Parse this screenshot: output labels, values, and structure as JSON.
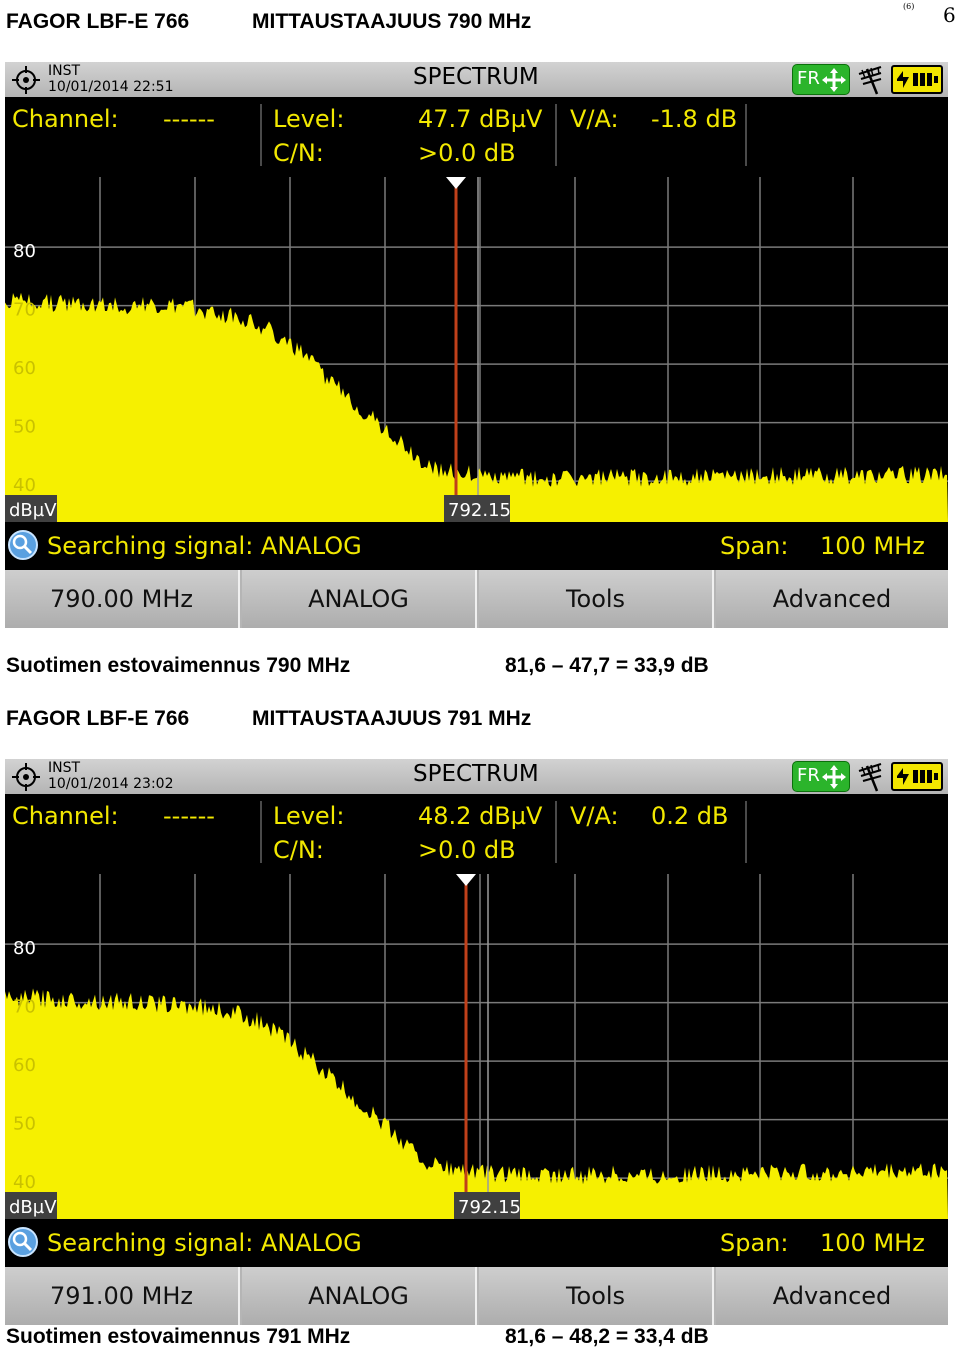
{
  "page": {
    "page_number_small": "(6)",
    "page_number": "6"
  },
  "sections": [
    {
      "model": "FAGOR LBF-E 766",
      "heading": "MITTAUSTAAJUUS 790 MHz",
      "caption": "Suotimen estovaimennus 790 MHz",
      "calculation": "81,6 – 47,7 = 33,9 dB",
      "screen": {
        "mode": "INST",
        "datetime": "10/01/2014 22:51",
        "title": "SPECTRUM",
        "fr_label": "FR",
        "channel_label": "Channel:",
        "channel_value": "------",
        "level_label": "Level:",
        "level_value": "47.7 dBµV",
        "cn_label": "C/N:",
        "cn_value": ">0.0 dB",
        "va_label": "V/A:",
        "va_value": "-1.8 dB",
        "search_text": "Searching signal: ANALOG",
        "span_label": "Span:",
        "span_value": "100 MHz",
        "softkeys": [
          "790.00 MHz",
          "ANALOG",
          "Tools",
          "Advanced"
        ]
      }
    },
    {
      "model": "FAGOR LBF-E 766",
      "heading": "MITTAUSTAAJUUS 791 MHz",
      "caption": "Suotimen estovaimennus 791 MHz",
      "calculation": "81,6 – 48,2 = 33,4 dB",
      "screen": {
        "mode": "INST",
        "datetime": "10/01/2014 23:02",
        "title": "SPECTRUM",
        "fr_label": "FR",
        "channel_label": "Channel:",
        "channel_value": "------",
        "level_label": "Level:",
        "level_value": "48.2 dBµV",
        "cn_label": "C/N:",
        "cn_value": ">0.0 dB",
        "va_label": "V/A:",
        "va_value": "0.2 dB",
        "search_text": "Searching signal: ANALOG",
        "span_label": "Span:",
        "span_value": "100 MHz",
        "softkeys": [
          "791.00 MHz",
          "ANALOG",
          "Tools",
          "Advanced"
        ]
      }
    }
  ],
  "chart_data": [
    {
      "type": "area",
      "title": "SPECTRUM",
      "ylabel": "dBµV",
      "yticks": [
        80,
        70,
        60,
        50,
        40
      ],
      "ylim": [
        33,
        92
      ],
      "marker_label": "792.15",
      "fill_color": "#f6f000",
      "marker_color": "#c0401a",
      "series": [
        {
          "x": [
            0,
            2,
            5,
            10,
            15,
            20,
            22,
            25,
            28,
            30,
            32,
            34,
            36,
            38,
            40,
            42,
            44,
            46,
            48,
            50,
            55,
            60,
            70,
            80,
            90,
            100
          ],
          "y": [
            70.5,
            71,
            70.5,
            70.3,
            70,
            69.5,
            69,
            68,
            66,
            63.5,
            61,
            58,
            55,
            52,
            49.5,
            46.5,
            43.5,
            42,
            41.5,
            41,
            40.5,
            40.5,
            40.6,
            40.8,
            41,
            41.2
          ]
        }
      ]
    },
    {
      "type": "area",
      "title": "SPECTRUM",
      "ylabel": "dBµV",
      "yticks": [
        80,
        70,
        60,
        50,
        40
      ],
      "ylim": [
        33,
        92
      ],
      "marker_label": "792.15",
      "fill_color": "#f6f000",
      "marker_color": "#c0401a",
      "series": [
        {
          "x": [
            0,
            2,
            5,
            10,
            15,
            20,
            22,
            25,
            28,
            30,
            32,
            34,
            36,
            38,
            40,
            42,
            44,
            46,
            48,
            50,
            55,
            60,
            70,
            80,
            90,
            100
          ],
          "y": [
            70.5,
            71,
            70.5,
            70.3,
            70,
            69.5,
            69,
            68,
            66,
            63.5,
            61,
            58,
            55,
            52,
            49.5,
            46.5,
            43.5,
            42,
            41.5,
            41,
            40.5,
            40.5,
            40.6,
            40.8,
            41,
            41.2
          ]
        }
      ]
    }
  ]
}
